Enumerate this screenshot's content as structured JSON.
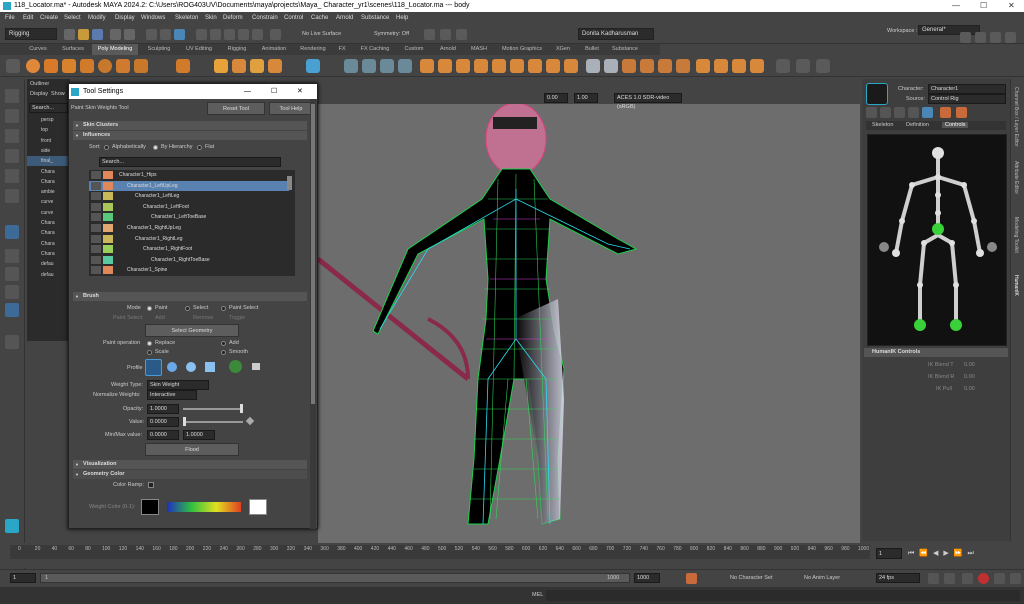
{
  "window": {
    "title": "118_Locator.ma* - Autodesk MAYA 2024.2: C:\\Users\\ROG403UV\\Documents\\maya\\projects\\Maya_ Character_yr1\\scenes\\118_Locator.ma    ---    body"
  },
  "menu": [
    "File",
    "Edit",
    "Create",
    "Select",
    "Modify",
    "Display",
    "Windows",
    "Skeleton",
    "Skin",
    "Deform",
    "Constrain",
    "Control",
    "Cache",
    "Arnold",
    "Substance",
    "Help"
  ],
  "workspace": {
    "label": "Workspace :",
    "value": "General*"
  },
  "status": {
    "mode": "Rigging",
    "live": "No Live Surface",
    "symmetry": "Symmetry: Off",
    "user": "Donita Kadharusman"
  },
  "shelf_tabs": [
    "Curves",
    "Surfaces",
    "Poly Modeling",
    "Sculpting",
    "UV Editing",
    "Rigging",
    "Animation",
    "Rendering",
    "FX",
    "FX Caching",
    "Custom",
    "Arnold",
    "MASH",
    "Motion Graphics",
    "XGen",
    "Bullet",
    "Substance"
  ],
  "shelf_active": "Poly Modeling",
  "outliner": {
    "title": "Outliner",
    "menus": [
      "Display",
      "Show"
    ],
    "search": "Search...",
    "items": [
      "persp",
      "top",
      "front",
      "side",
      "final_",
      "Chara",
      "Chara",
      "ambie",
      "curve",
      "curve",
      "Chara",
      "Chara",
      "Chara",
      "Chara",
      "defau",
      "defau"
    ]
  },
  "tool": {
    "title": "Tool Settings",
    "name": "Paint Skin Weights Tool",
    "reset": "Reset Tool",
    "help": "Tool Help",
    "sections": {
      "skin_clusters": "Skin Clusters",
      "influences": "Influences",
      "brush": "Brush",
      "visualization": "Visualization",
      "geometry_color": "Geometry Color"
    },
    "sort_label": "Sort:",
    "sort_opts": [
      "Alphabetically",
      "By Hierarchy",
      "Flat"
    ],
    "search": "Search...",
    "influences": [
      {
        "name": "Character1_Hips",
        "indent": 0,
        "color": "#e0885a"
      },
      {
        "name": "Character1_LeftUpLeg",
        "indent": 1,
        "color": "#e0885a"
      },
      {
        "name": "Character1_LeftLeg",
        "indent": 2,
        "color": "#c8b85a"
      },
      {
        "name": "Character1_LeftFoot",
        "indent": 3,
        "color": "#a8c85a"
      },
      {
        "name": "Character1_LeftToeBase",
        "indent": 4,
        "color": "#5ac87a"
      },
      {
        "name": "Character1_RightUpLeg",
        "indent": 1,
        "color": "#e0a870"
      },
      {
        "name": "Character1_RightLeg",
        "indent": 2,
        "color": "#c8b85a"
      },
      {
        "name": "Character1_RightFoot",
        "indent": 3,
        "color": "#9ad05a"
      },
      {
        "name": "Character1_RightToeBase",
        "indent": 4,
        "color": "#5ac8a0"
      },
      {
        "name": "Character1_Spine",
        "indent": 1,
        "color": "#e0885a"
      }
    ],
    "mode_label": "Mode",
    "mode_opts": [
      "Paint",
      "Select",
      "Paint Select"
    ],
    "paint_select_label": "Paint Select",
    "paint_select_opts": [
      "Add",
      "Remove",
      "Toggle"
    ],
    "select_geometry": "Select Geometry",
    "paint_op_label": "Paint operation",
    "paint_ops": [
      "Replace",
      "Add",
      "Scale",
      "Smooth"
    ],
    "profile_label": "Profile",
    "weight_type_label": "Weight Type:",
    "weight_type": "Skin Weight",
    "normalize_label": "Normalize Weights:",
    "normalize": "Interactive",
    "opacity_label": "Opacity:",
    "opacity": "1.0000",
    "value_label": "Value:",
    "value": "0.0000",
    "minmax_label": "Min/Max value:",
    "min": "0.0000",
    "max": "1.0000",
    "flood": "Flood",
    "color_ramp_label": "Color Ramp:",
    "weight_color_label": "Weight Color (0-1):"
  },
  "viewport": {
    "exposure": "0.00",
    "gamma": "1.00",
    "colorspace": "ACES 1.0 SDR-video (sRGB)"
  },
  "hik": {
    "character_label": "Character:",
    "character": "Character1",
    "source_label": "Source:",
    "source": "Control Rig",
    "tabs": [
      "Skeleton",
      "Definition",
      "Controls"
    ],
    "active_tab": "Controls",
    "controls_title": "HumanIK Controls",
    "ik_blend_t": "IK Blend T",
    "ik_blend_r": "IK Blend R",
    "ik_pull": "IK Pull",
    "v1": "0.00",
    "v2": "0.00",
    "v3": "0.00"
  },
  "side_tabs": [
    "Channel Box / Layer Editor",
    "Attribute Editor",
    "Modeling Toolkit",
    "HumanIK"
  ],
  "timeline": {
    "ticks": [
      "0",
      "20",
      "40",
      "60",
      "80",
      "100",
      "120",
      "140",
      "160",
      "180",
      "200",
      "220",
      "240",
      "260",
      "280",
      "300",
      "320",
      "340",
      "360",
      "380",
      "400",
      "420",
      "440",
      "460",
      "480",
      "500",
      "520",
      "540",
      "560",
      "580",
      "600",
      "620",
      "640",
      "660",
      "680",
      "700",
      "720",
      "740",
      "760",
      "780",
      "800",
      "820",
      "840",
      "860",
      "880",
      "900",
      "920",
      "940",
      "960",
      "980",
      "1000"
    ],
    "current": "1"
  },
  "range": {
    "start": "1",
    "inner_start": "1",
    "inner_end": "1000",
    "end": "1000",
    "char_set": "No Character Set",
    "anim_layer": "No Anim Layer",
    "fps": "24 fps"
  },
  "cmd": {
    "label": "MEL"
  }
}
